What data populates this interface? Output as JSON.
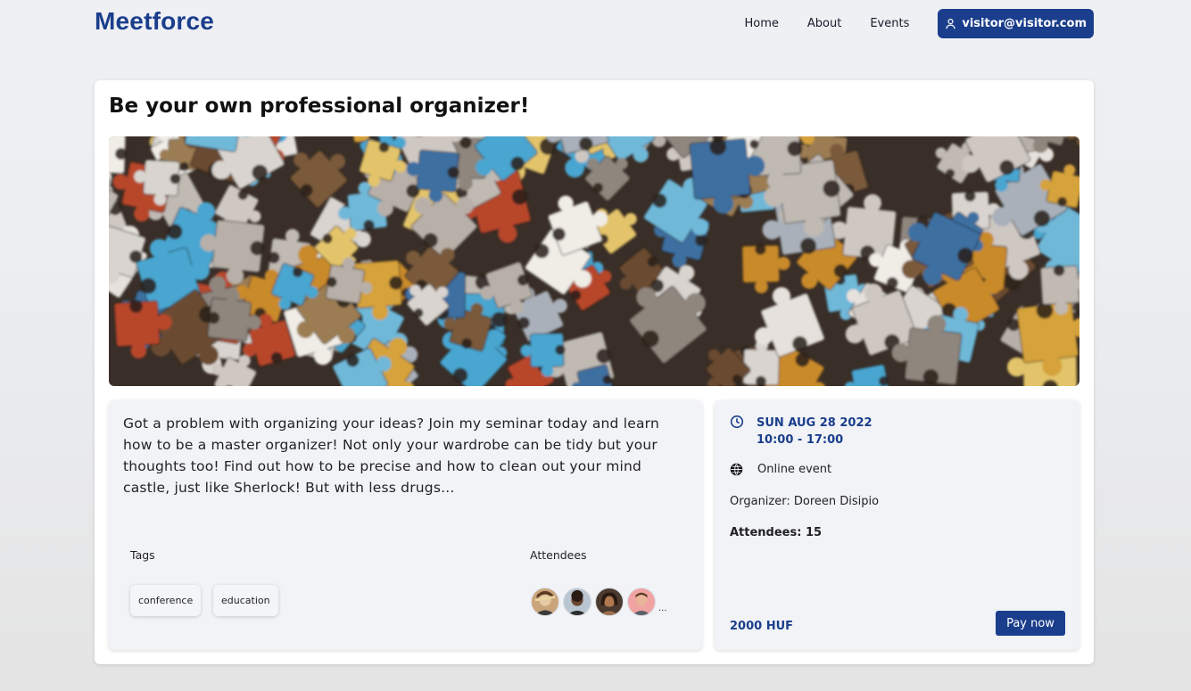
{
  "header": {
    "brand": "Meetforce",
    "nav": [
      {
        "label": "Home"
      },
      {
        "label": "About"
      },
      {
        "label": "Events"
      }
    ],
    "user_email": "visitor@visitor.com"
  },
  "event": {
    "title": "Be your own professional organizer!",
    "description": "Got a problem with organizing your ideas? Join my seminar today and learn how to be a master organizer! Not only your wardrobe can be tidy but your thoughts too! Find out how to be precise and how to clean out your mind castle, just like Sherlock! But with less drugs...",
    "tags_label": "Tags",
    "tags": [
      "conference",
      "education"
    ],
    "attendees_label": "Attendees",
    "attendees_more": "...",
    "date": "SUN AUG 28 2022",
    "time": "10:00 - 17:00",
    "location": "Online event",
    "organizer": "Organizer: Doreen Disipio",
    "attendees_count": "Attendees: 15",
    "price": "2000 HUF",
    "pay_label": "Pay now"
  },
  "icons": {
    "user": "user-icon",
    "clock": "clock-icon",
    "globe": "globe-icon"
  },
  "colors": {
    "brand": "#1b3e8c",
    "panel": "#f1f3f6",
    "background": "#eceef1"
  }
}
